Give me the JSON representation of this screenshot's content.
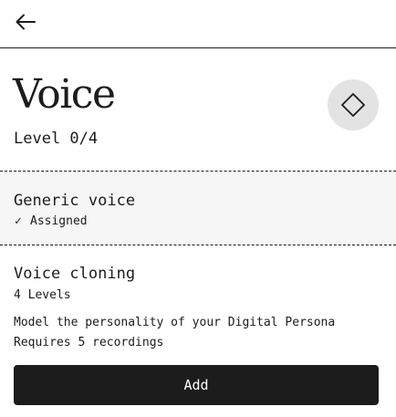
{
  "header": {
    "back_icon": "arrow-left-icon"
  },
  "page": {
    "title": "Voice",
    "level": "Level 0/4",
    "action_icon": "diamond-icon",
    "action_bg_color": "#e3e3e3"
  },
  "generic_voice": {
    "title": "Generic voice",
    "status_icon": "check-icon",
    "status_glyph": "✓",
    "status": "Assigned",
    "bg_color": "#f6f6f6"
  },
  "voice_cloning": {
    "title": "Voice cloning",
    "levels": "4 Levels",
    "description": "Model the personality of your Digital Persona",
    "requirement": "Requires 5 recordings",
    "add_label": "Add",
    "button_color": "#1c1c1c"
  }
}
